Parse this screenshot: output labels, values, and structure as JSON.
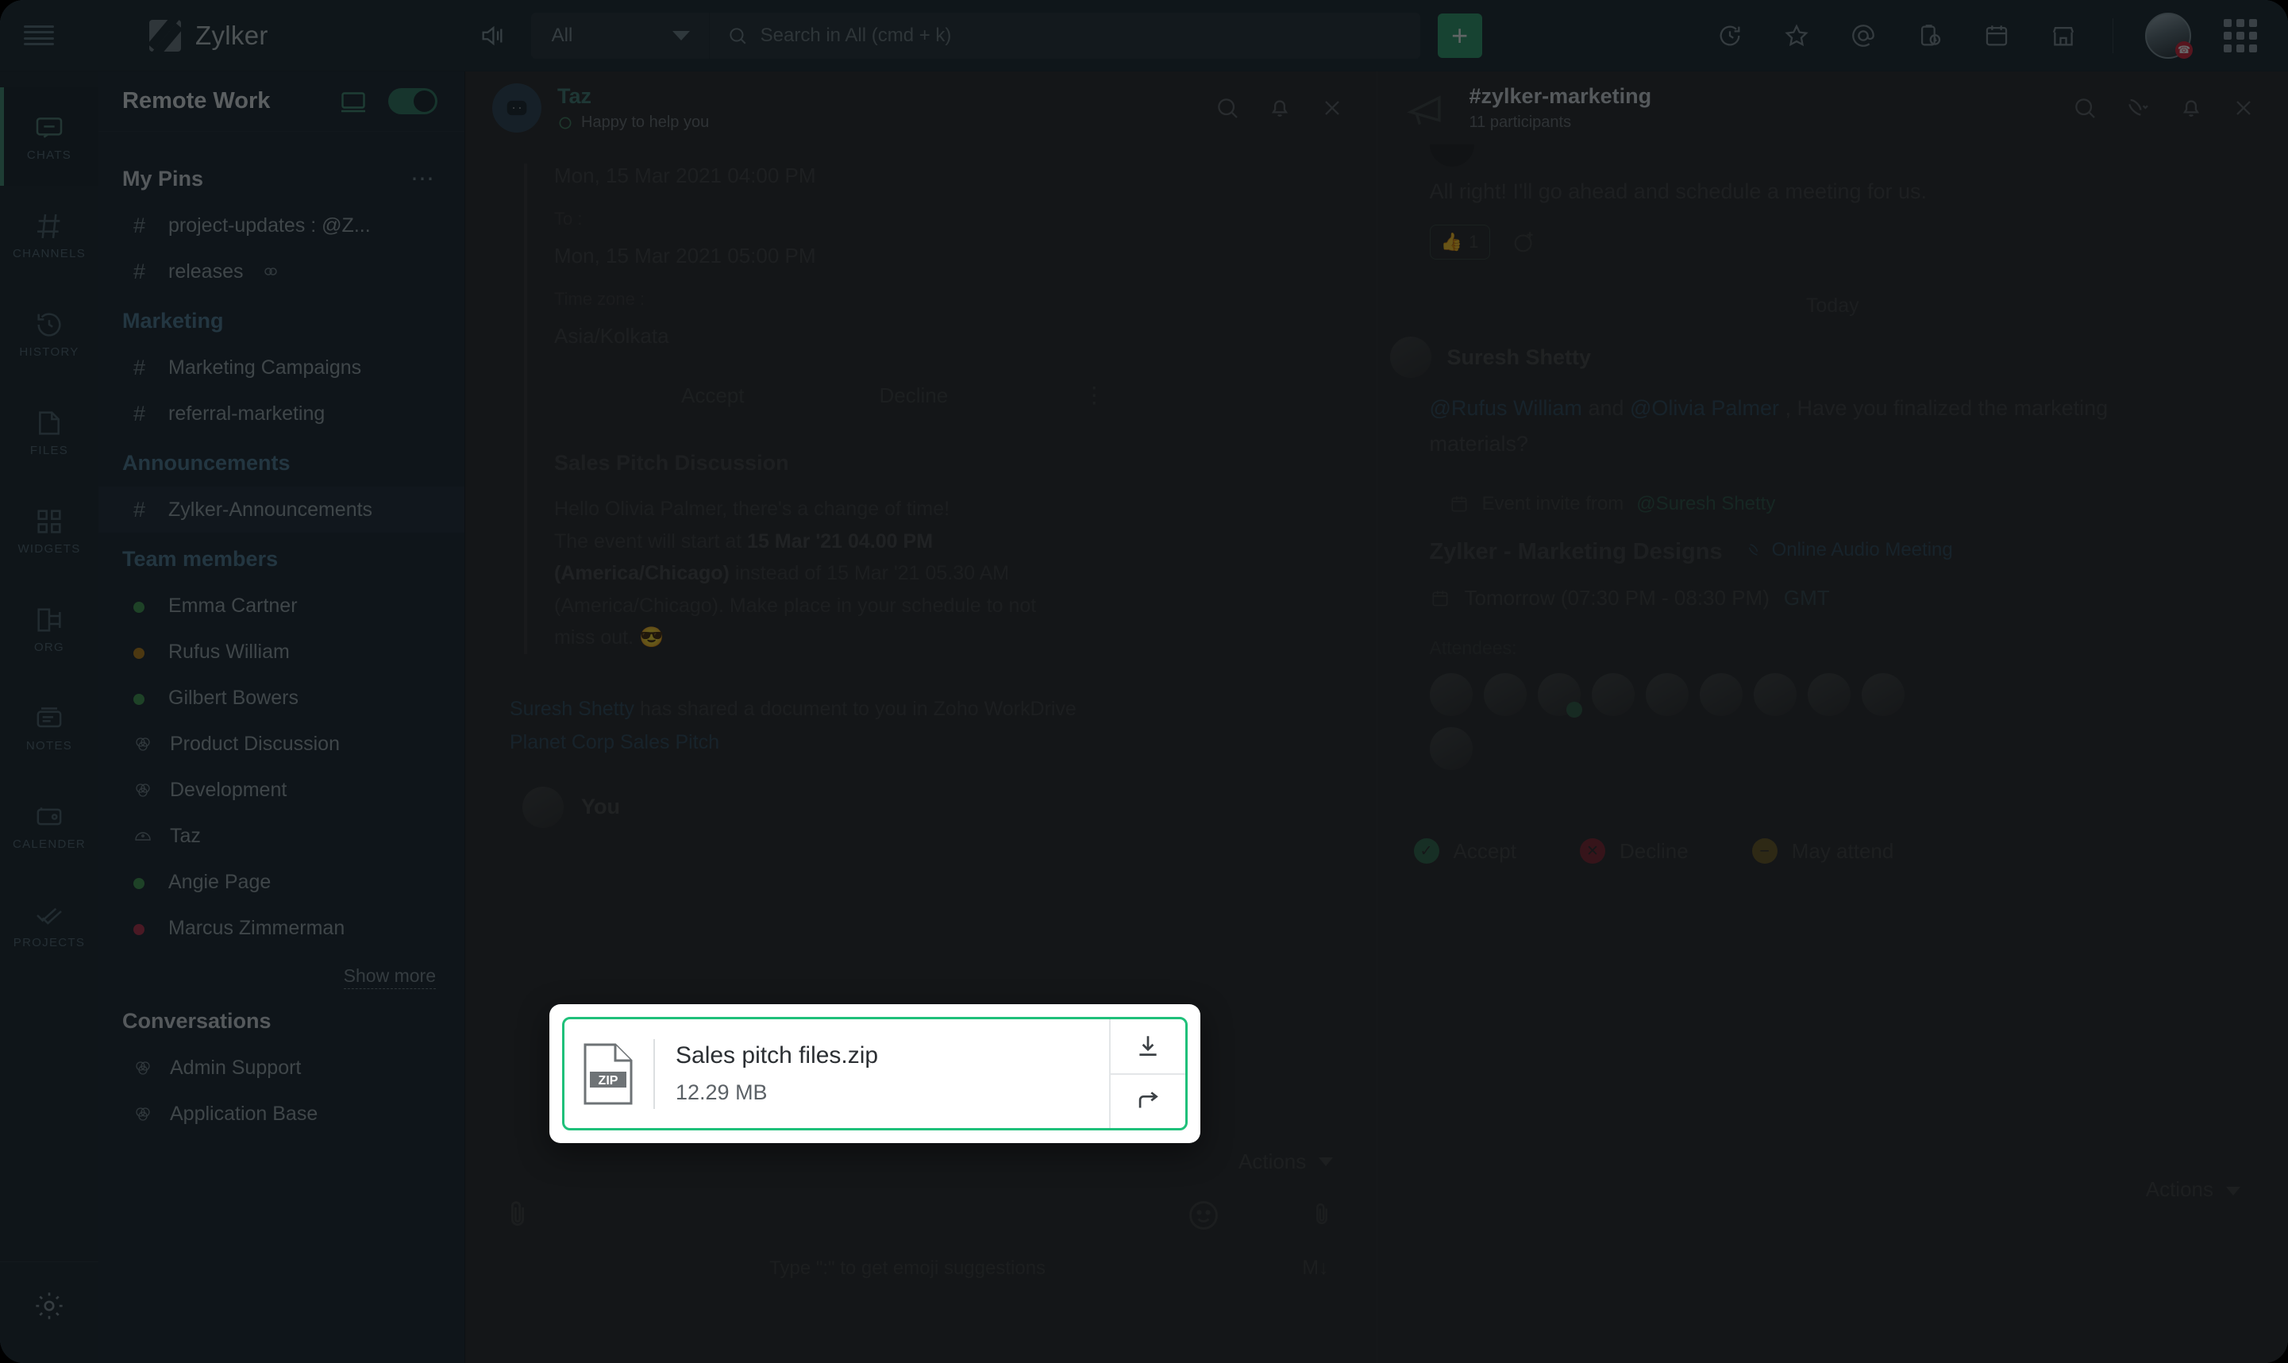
{
  "topbar": {
    "menu_icon": "hamburger-icon",
    "brand": "Zylker",
    "speaker_icon": "speaker-announce-icon",
    "search_scope": "All",
    "search_placeholder": "Search in All (cmd + k)",
    "new_label": "+",
    "right_icons": [
      "history-icon",
      "star-icon",
      "mentions-icon",
      "clipboard-clock-icon",
      "calendar-icon",
      "marketplace-icon",
      "apps-grid-icon"
    ]
  },
  "rail": {
    "items": [
      {
        "label": "CHATS",
        "icon": "chat-bubble-icon",
        "active": true
      },
      {
        "label": "CHANNELS",
        "icon": "hash-icon",
        "active": false
      },
      {
        "label": "HISTORY",
        "icon": "history-clock-icon",
        "active": false
      },
      {
        "label": "FILES",
        "icon": "file-icon",
        "active": false
      },
      {
        "label": "WIDGETS",
        "icon": "widgets-grid-icon",
        "active": false
      },
      {
        "label": "ORG",
        "icon": "org-chart-icon",
        "active": false
      },
      {
        "label": "NOTES",
        "icon": "notes-icon",
        "active": false
      },
      {
        "label": "CALENDER",
        "icon": "calendar-icon",
        "active": false
      },
      {
        "label": "PROJECTS",
        "icon": "checkmarks-icon",
        "active": false
      }
    ],
    "settings_icon": "gear-icon"
  },
  "sidebar": {
    "title": "Remote Work",
    "desktop_icon": "desktop-icon",
    "toggle_on": true,
    "sections": [
      {
        "title": "My Pins",
        "accent": false,
        "has_more": true,
        "items": [
          {
            "label": "project-updates : @Z...",
            "glyph": "hash",
            "selected": false
          },
          {
            "label": "releases",
            "glyph": "hash",
            "selected": false,
            "suffix_icon": "link-icon"
          }
        ]
      },
      {
        "title": "Marketing",
        "accent": true,
        "has_more": false,
        "items": [
          {
            "label": "Marketing Campaigns",
            "glyph": "hash",
            "selected": false
          },
          {
            "label": "referral-marketing",
            "glyph": "hash",
            "selected": false
          }
        ]
      },
      {
        "title": "Announcements",
        "accent": true,
        "has_more": false,
        "items": [
          {
            "label": "Zylker-Announcements",
            "glyph": "hash",
            "selected": true
          }
        ]
      },
      {
        "title": "Team members",
        "accent": true,
        "has_more": false,
        "items": [
          {
            "label": "Emma  Cartner",
            "glyph": "dot",
            "color": "#3f9c52",
            "selected": false
          },
          {
            "label": "Rufus William",
            "glyph": "dot",
            "color": "#b98019",
            "selected": false
          },
          {
            "label": "Gilbert Bowers",
            "glyph": "dot",
            "color": "#3f9c52",
            "selected": false
          },
          {
            "label": "Product Discussion",
            "glyph": "group",
            "selected": false
          },
          {
            "label": "Development",
            "glyph": "group",
            "selected": false
          },
          {
            "label": "Taz",
            "glyph": "bot",
            "selected": false
          },
          {
            "label": "Angie Page",
            "glyph": "dot",
            "color": "#3f9c52",
            "selected": false
          },
          {
            "label": "Marcus Zimmerman",
            "glyph": "dot",
            "color": "#b2314a",
            "selected": false
          }
        ]
      }
    ],
    "show_more": "Show more",
    "conversations": {
      "title": "Conversations",
      "items": [
        {
          "label": "Admin Support",
          "glyph": "group"
        },
        {
          "label": "Application Base",
          "glyph": "group"
        }
      ]
    }
  },
  "left_pane": {
    "header": {
      "name": "Taz",
      "status": "Happy to help you",
      "status_icon": "bot-status-icon",
      "icons": [
        "search-icon",
        "bell-icon",
        "close-icon"
      ]
    },
    "quoted": {
      "from_time": "Mon, 15 Mar 2021 04:00 PM",
      "to_label": "To :",
      "to_time": "Mon, 15 Mar 2021 05:00 PM",
      "tz_label": "Time zone :",
      "tz_value": "Asia/Kolkata"
    },
    "rsvp": {
      "accept": "Accept",
      "decline": "Decline",
      "more_icon": "kebab-icon"
    },
    "card": {
      "title": "Sales Pitch Discussion",
      "line1": "Hello Olivia Palmer, there's a change of time!",
      "line2_pre": "The event will start at ",
      "line2_bold": "15 Mar '21 04.00 PM",
      "line3_bold": "(America/Chicago)",
      "line3_post": " instead of 15 Mar '21 05.30 AM",
      "line4": "(America/Chicago). Make place in your schedule to not",
      "line5": "miss out. ",
      "emoji": "😎"
    },
    "share": {
      "who": "Suresh Shetty",
      "text": " has shared a document to you in Zoho WorkDrive",
      "doc": "Planet Corp Sales Pitch"
    },
    "you_label": "You",
    "composer": {
      "attach_icon": "paperclip-icon",
      "emoji_icon": "smiley-icon",
      "more_icon": "paperclip-alt-icon",
      "hint": "Type \":\" to get emoji suggestions",
      "markdown_label": "M↓"
    }
  },
  "right_pane": {
    "header": {
      "name": "#zylker-marketing",
      "participants": "11 participants",
      "avatar_icon": "megaphone-icon",
      "icons": [
        "search-icon",
        "call-icon",
        "bell-icon",
        "close-icon"
      ]
    },
    "message_top": "All right! I'll go ahead and schedule a meeting for us.",
    "reaction": {
      "emoji": "👍",
      "count": "1",
      "add_icon": "add-reaction-icon"
    },
    "day_separator": "Today",
    "message": {
      "author": "Suresh Shetty",
      "mention1": "@Rufus William",
      "joiner": " and ",
      "mention2": "@Olivia Palmer",
      "rest": " , Have you finalized the marketing",
      "rest2": "materials?"
    },
    "invite": {
      "label_pre": "Event invite from ",
      "label_who": "@Suresh Shetty",
      "calendar_icon": "calendar-icon",
      "title": "Zylker - Marketing Designs",
      "mode": "Online Audio Meeting",
      "mode_icon": "phone-icon",
      "when": "Tomorrow (07:30 PM - 08:30 PM)",
      "timezone": "GMT",
      "attendees_label": "Attendees:",
      "attendees_count": 10,
      "rsvp": {
        "accept": "Accept",
        "decline": "Decline",
        "may": "May attend"
      }
    },
    "actions_label": "Actions"
  },
  "file_modal": {
    "file_type": "ZIP",
    "file_name": "Sales pitch files.zip",
    "file_size": "12.29 MB",
    "download_icon": "download-icon",
    "forward_icon": "forward-icon",
    "accent_color": "#1fc07a"
  }
}
